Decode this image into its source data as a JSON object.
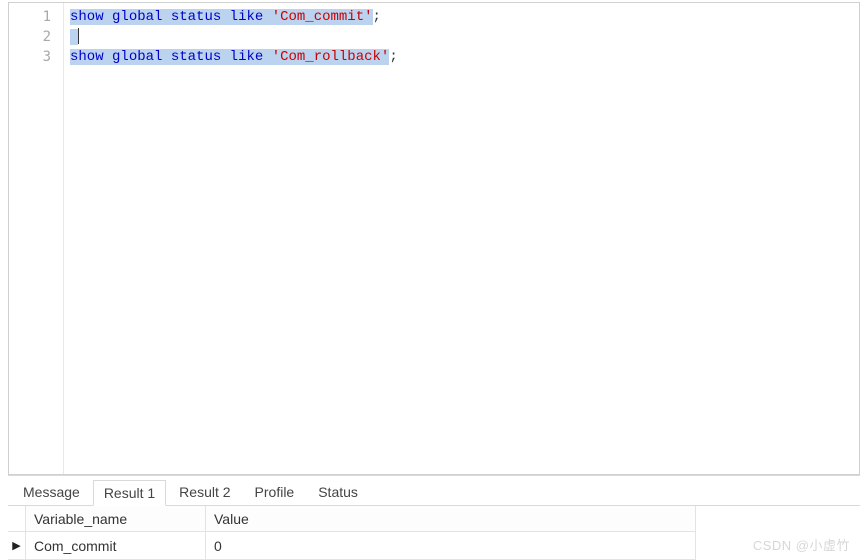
{
  "editor": {
    "lines": [
      {
        "num": "1",
        "tokens": [
          {
            "cls": "kw",
            "t": "show"
          },
          {
            "cls": "",
            "t": " "
          },
          {
            "cls": "kw",
            "t": "global"
          },
          {
            "cls": "",
            "t": " "
          },
          {
            "cls": "kw",
            "t": "status"
          },
          {
            "cls": "",
            "t": " "
          },
          {
            "cls": "kw",
            "t": "like"
          },
          {
            "cls": "",
            "t": " "
          },
          {
            "cls": "str",
            "t": "'Com_commit'"
          }
        ],
        "trailing": ";",
        "highlighted": true
      },
      {
        "num": "2",
        "tokens": [],
        "trailing": "",
        "highlighted_empty": true
      },
      {
        "num": "3",
        "tokens": [
          {
            "cls": "kw",
            "t": "show"
          },
          {
            "cls": "",
            "t": " "
          },
          {
            "cls": "kw",
            "t": "global"
          },
          {
            "cls": "",
            "t": " "
          },
          {
            "cls": "kw",
            "t": "status"
          },
          {
            "cls": "",
            "t": " "
          },
          {
            "cls": "kw",
            "t": "like"
          },
          {
            "cls": "",
            "t": " "
          },
          {
            "cls": "str",
            "t": "'Com_rollback'"
          }
        ],
        "trailing": ";",
        "highlighted": true
      }
    ]
  },
  "tabs": [
    {
      "label": "Message",
      "active": false
    },
    {
      "label": "Result 1",
      "active": true
    },
    {
      "label": "Result 2",
      "active": false
    },
    {
      "label": "Profile",
      "active": false
    },
    {
      "label": "Status",
      "active": false
    }
  ],
  "grid": {
    "headers": [
      "Variable_name",
      "Value"
    ],
    "rows": [
      {
        "indicator": "▶",
        "cells": [
          "Com_commit",
          "0"
        ]
      }
    ]
  },
  "watermark": "CSDN @小虚竹"
}
